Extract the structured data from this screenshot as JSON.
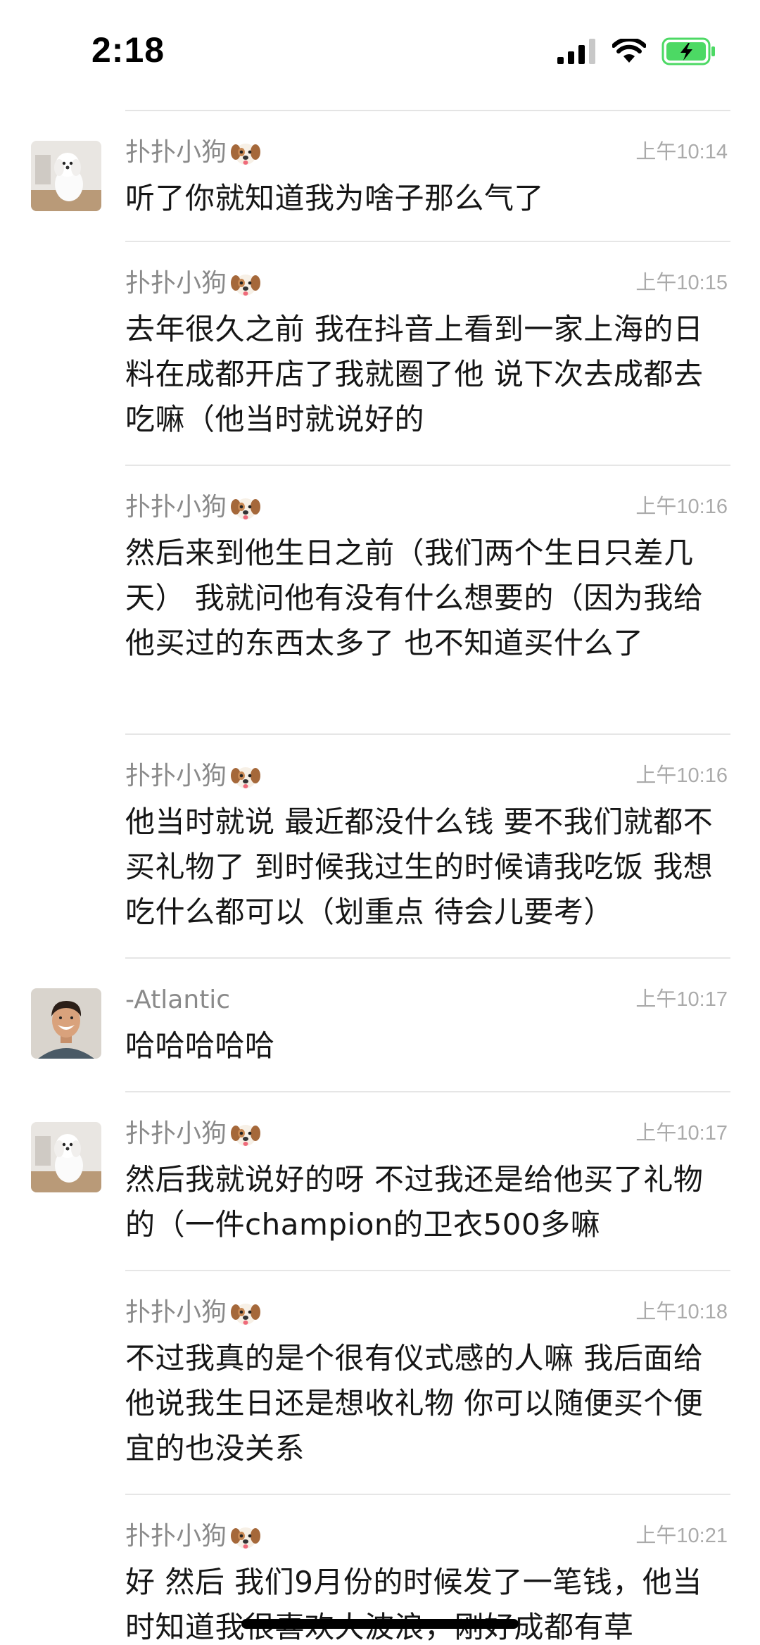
{
  "status_bar": {
    "time": "2:18",
    "battery_color": "#4cd964"
  },
  "messages": [
    {
      "sender": "扑扑小狗",
      "time": "上午10:14",
      "text": "听了你就知道我为啥子那么气了",
      "avatar": "dog-avatar"
    },
    {
      "sender": "扑扑小狗",
      "time": "上午10:15",
      "text": "去年很久之前 我在抖音上看到一家上海的日料在成都开店了我就圈了他 说下次去成都去吃嘛（他当时就说好的"
    },
    {
      "sender": "扑扑小狗",
      "time": "上午10:16",
      "text": "然后来到他生日之前（我们两个生日只差几天） 我就问他有没有什么想要的（因为我给他买过的东西太多了 也不知道买什么了"
    },
    {
      "sender": "扑扑小狗",
      "time": "上午10:16",
      "text": "他当时就说 最近都没什么钱 要不我们就都不买礼物了 到时候我过生的时候请我吃饭 我想吃什么都可以（划重点 待会儿要考）"
    },
    {
      "sender": "-Atlantic",
      "time": "上午10:17",
      "text": "哈哈哈哈哈",
      "avatar": "man-avatar"
    },
    {
      "sender": "扑扑小狗",
      "time": "上午10:17",
      "text": "然后我就说好的呀 不过我还是给他买了礼物的（一件champion的卫衣500多嘛",
      "avatar": "dog-avatar"
    },
    {
      "sender": "扑扑小狗",
      "time": "上午10:18",
      "text": "不过我真的是个很有仪式感的人嘛 我后面给他说我生日还是想收礼物 你可以随便买个便宜的也没关系"
    },
    {
      "sender": "扑扑小狗",
      "time": "上午10:21",
      "text": "好 然后 我们9月份的时候发了一笔钱，他当时知道我很喜欢大波浪，刚好成都有草"
    }
  ]
}
